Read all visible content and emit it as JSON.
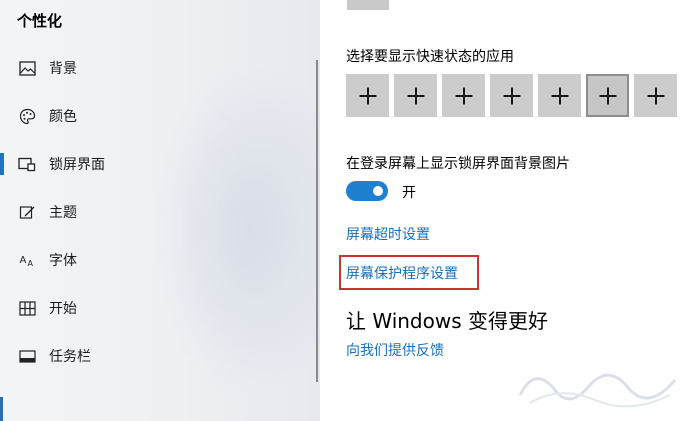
{
  "sidebar": {
    "title": "个性化",
    "items": [
      {
        "label": "背景",
        "icon": "image-icon"
      },
      {
        "label": "颜色",
        "icon": "palette-icon"
      },
      {
        "label": "锁屏界面",
        "icon": "lock-screen-icon",
        "active": true
      },
      {
        "label": "主题",
        "icon": "theme-brush-icon"
      },
      {
        "label": "字体",
        "icon": "font-icon"
      },
      {
        "label": "开始",
        "icon": "start-grid-icon"
      },
      {
        "label": "任务栏",
        "icon": "taskbar-icon"
      }
    ]
  },
  "main": {
    "quick_status_label": "选择要显示快速状态的应用",
    "quick_status_tiles": [
      "+",
      "+",
      "+",
      "+",
      "+",
      "+",
      "+"
    ],
    "selected_tile_index": 5,
    "show_bg_label": "在登录屏幕上显示锁屏界面背景图片",
    "toggle_state": "开",
    "screen_timeout_link": "屏幕超时设置",
    "screensaver_link": "屏幕保护程序设置",
    "improve_heading": "让 Windows 变得更好",
    "feedback_link": "向我们提供反馈"
  },
  "colors": {
    "accent": "#1f7fd0",
    "link": "#1b6fb8",
    "highlight_box": "#c8342f"
  }
}
